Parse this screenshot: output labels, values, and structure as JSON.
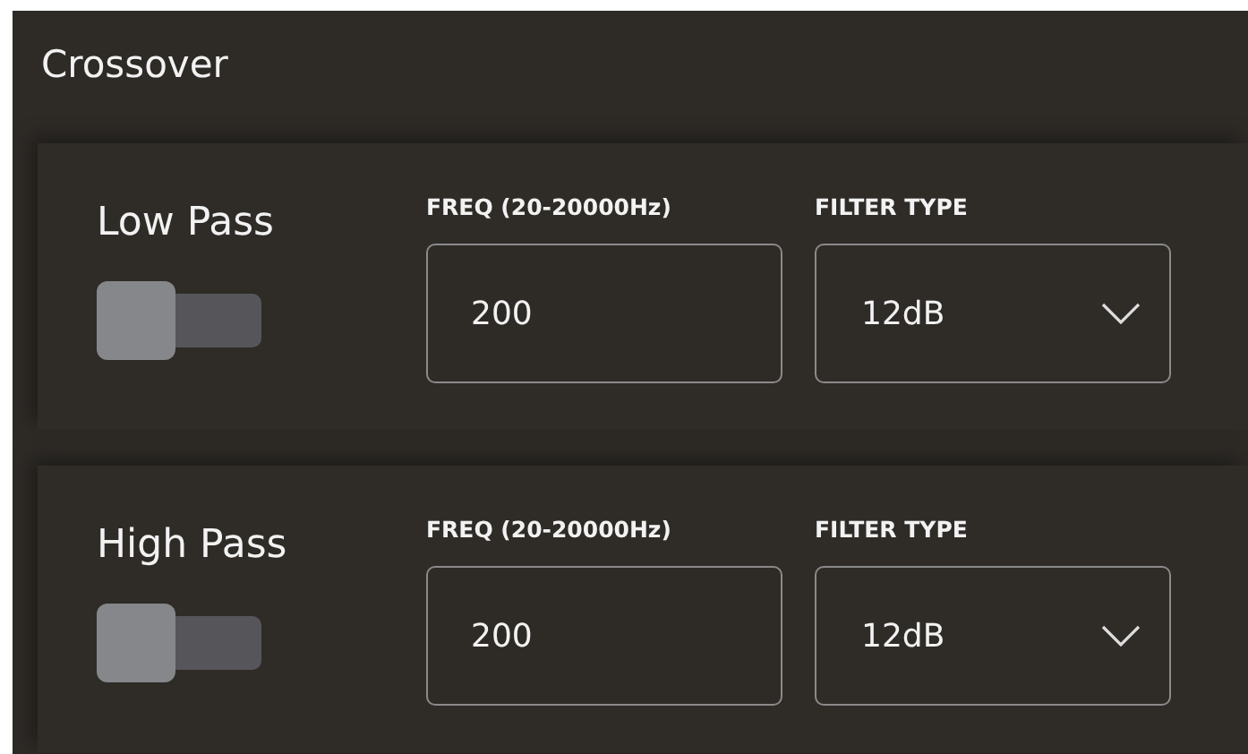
{
  "title": "Crossover",
  "filters": [
    {
      "name": "Low Pass",
      "on": false,
      "freq_label": "FREQ (20-20000Hz)",
      "freq_value": "200",
      "type_label": "FILTER TYPE",
      "type_value": "12dB"
    },
    {
      "name": "High Pass",
      "on": false,
      "freq_label": "FREQ (20-20000Hz)",
      "freq_value": "200",
      "type_label": "FILTER TYPE",
      "type_value": "12dB"
    }
  ]
}
